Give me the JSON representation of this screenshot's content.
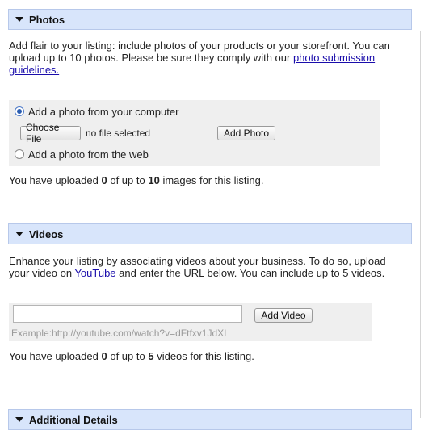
{
  "photos": {
    "header": "Photos",
    "description_text": "Add flair to your listing: include photos of your products or your storefront. You can upload up to 10 photos. Please be sure they comply with our",
    "guidelines_link": "photo submission guidelines.",
    "option_computer": "Add a photo from your computer",
    "choose_file_label": "Choose File",
    "no_file_text": "no file selected",
    "add_photo_label": "Add Photo",
    "option_web": "Add a photo from the web",
    "status_prefix": "You have uploaded",
    "status_count": "0",
    "status_middle": "of up to",
    "status_max": "10",
    "status_suffix": "images for this listing."
  },
  "videos": {
    "header": "Videos",
    "description_prefix": "Enhance your listing by associating videos about your business. To do so, upload your video on",
    "youtube_link": "YouTube",
    "description_suffix": "and enter the URL below. You can include up to 5 videos.",
    "url_value": "",
    "add_video_label": "Add Video",
    "example_text": "Example:http://youtube.com/watch?v=dFtfxv1JdXI",
    "status_prefix": "You have uploaded",
    "status_count": "0",
    "status_middle": "of up to",
    "status_max": "5",
    "status_suffix": "videos for this listing."
  },
  "additional": {
    "header": "Additional Details"
  }
}
